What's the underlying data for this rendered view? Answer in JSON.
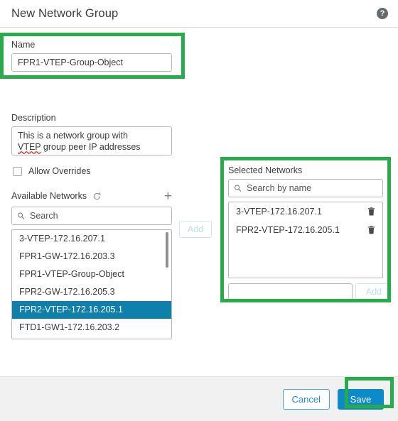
{
  "header": {
    "title": "New Network Group",
    "help_icon": "help-circle-icon",
    "help_glyph": "?"
  },
  "form": {
    "name": {
      "label": "Name",
      "value": "FPR1-VTEP-Group-Object",
      "placeholder": ""
    },
    "description": {
      "label": "Description",
      "value_line1": "This is a network group with",
      "value_misspelled": "VTEP",
      "value_line2": " group peer IP addresses",
      "placeholder": ""
    },
    "allow_overrides": {
      "label": "Allow Overrides",
      "checked": false
    }
  },
  "available": {
    "title": "Available Networks",
    "refresh_icon": "refresh-icon",
    "add_new_icon": "plus-icon",
    "search": {
      "placeholder": "Search",
      "value": "",
      "icon": "search-icon"
    },
    "items": [
      {
        "label": "3-VTEP-172.16.207.1",
        "selected": false
      },
      {
        "label": "FPR1-GW-172.16.203.3",
        "selected": false
      },
      {
        "label": "FPR1-VTEP-Group-Object",
        "selected": false
      },
      {
        "label": "FPR2-GW-172.16.205.3",
        "selected": false
      },
      {
        "label": "FPR2-VTEP-172.16.205.1",
        "selected": true
      },
      {
        "label": "FTD1-GW1-172.16.203.2",
        "selected": false
      }
    ]
  },
  "transfer": {
    "add_label": "Add",
    "add_enabled": false
  },
  "selected": {
    "title": "Selected Networks",
    "search": {
      "placeholder": "Search by name",
      "value": "",
      "icon": "search-icon"
    },
    "items": [
      {
        "label": "3-VTEP-172.16.207.1",
        "delete_icon": "trash-icon"
      },
      {
        "label": "FPR2-VTEP-172.16.205.1",
        "delete_icon": "trash-icon"
      }
    ],
    "manual_add": {
      "value": "",
      "placeholder": "",
      "button_label": "Add",
      "button_enabled": false
    }
  },
  "footer": {
    "cancel_label": "Cancel",
    "save_label": "Save"
  },
  "annotations": {
    "color": "#27ab4b",
    "boxes": [
      "name-field",
      "selected-networks-panel",
      "save-button"
    ]
  },
  "colors": {
    "accent": "#0d8bc9",
    "selection": "#0e80ab",
    "highlight": "#27ab4b",
    "footer_bg": "#f1f1f1",
    "text": "#3c3c3c",
    "border": "#b8b8b8"
  }
}
